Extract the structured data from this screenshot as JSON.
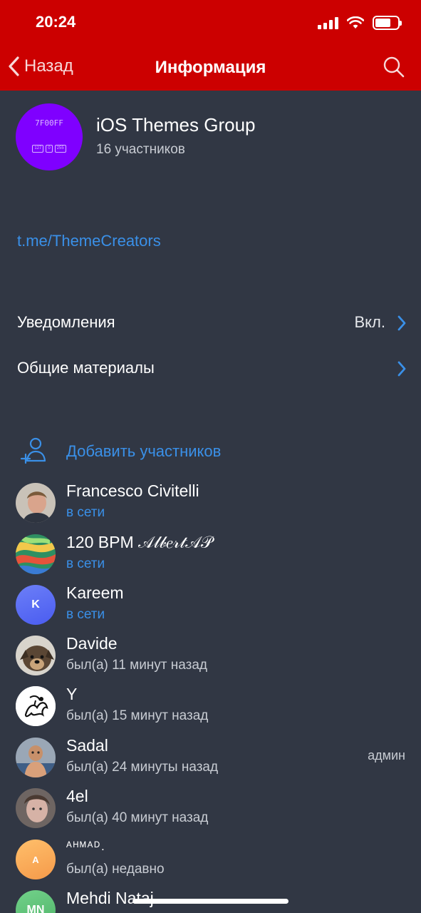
{
  "status_bar": {
    "time": "20:24",
    "battery_level": 0.7
  },
  "nav": {
    "back_label": "Назад",
    "title": "Информация"
  },
  "group": {
    "name": "iOS Themes Group",
    "members_count": "16 участников",
    "avatar_hex": "7F00FF",
    "avatar_rgb": [
      "127",
      "0",
      "255"
    ],
    "avatar_color": "#7f00ff"
  },
  "invite_link": "t.me/ThemeCreators",
  "settings": [
    {
      "label": "Уведомления",
      "value": "Вкл."
    },
    {
      "label": "Общие материалы",
      "value": ""
    }
  ],
  "add_members_label": "Добавить участников",
  "members": [
    {
      "name": "Francesco Civitelli",
      "status": "в сети",
      "online": true,
      "initials": "",
      "role": "",
      "avatar_color": "#8a7a6a"
    },
    {
      "name": "120 BPM 𝒜𝓁𝒷𝑒𝓇𝓉𝒜𝒫",
      "status": "в сети",
      "online": true,
      "initials": "",
      "role": "",
      "avatar_color": "#3aa86a"
    },
    {
      "name": "Kareem",
      "status": "в сети",
      "online": true,
      "initials": "K",
      "role": "",
      "avatar_color": "#5b6ef5"
    },
    {
      "name": "Davide",
      "status": "был(а) 11 минут назад",
      "online": false,
      "initials": "",
      "role": "",
      "avatar_color": "#6b5a48"
    },
    {
      "name": "Y",
      "status": "был(а) 15 минут назад",
      "online": false,
      "initials": "",
      "role": "",
      "avatar_color": "#ffffff"
    },
    {
      "name": "Sadal",
      "status": "был(а) 24 минуты назад",
      "online": false,
      "initials": "",
      "role": "админ",
      "avatar_color": "#7d8fa8"
    },
    {
      "name": "4el",
      "status": "был(а) 40 минут назад",
      "online": false,
      "initials": "",
      "role": "",
      "avatar_color": "#8a7a76"
    },
    {
      "name": "ᴬᴴᴹᴬᴰ.",
      "status": "был(а) недавно",
      "online": false,
      "initials": "A",
      "role": "",
      "avatar_color": "#f7a65a"
    },
    {
      "name": "Mehdi Nataj",
      "status": "",
      "online": false,
      "initials": "MN",
      "role": "",
      "avatar_color": "#5cc174"
    }
  ]
}
